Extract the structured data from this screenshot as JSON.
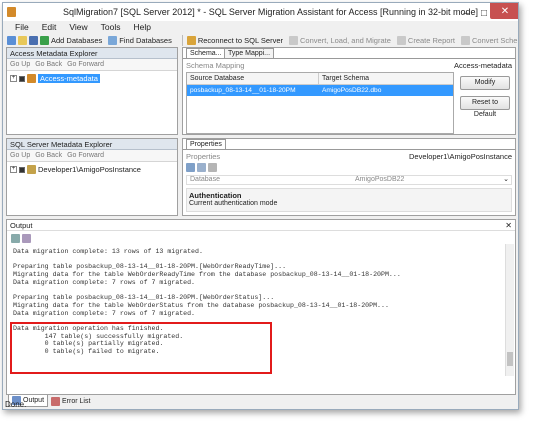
{
  "window": {
    "title": "SqlMigration7 [SQL Server 2012] * - SQL Server Migration Assistant for Access [Running in 32-bit mode]"
  },
  "menu": [
    "File",
    "Edit",
    "View",
    "Tools",
    "Help"
  ],
  "toolbar": {
    "add_databases": "Add Databases",
    "find_databases": "Find Databases",
    "reconnect": "Reconnect to SQL Server",
    "convert_load_migrate": "Convert, Load, and Migrate",
    "create_report": "Create Report",
    "convert_schema": "Convert Schema"
  },
  "access_explorer": {
    "title": "Access Metadata Explorer",
    "go_up": "Go Up",
    "go_back": "Go Back",
    "go_forward": "Go Forward",
    "root": "Access-metadata"
  },
  "schema_panel": {
    "tab_schema": "Schema...",
    "tab_type": "Type Mappi...",
    "schema_mapping": "Schema Mapping",
    "context": "Access-metadata",
    "col_source": "Source Database",
    "col_target": "Target Schema",
    "row_source": "posbackup_08-13-14__01-18-20PM",
    "row_target": "AmigoPosDB22.dbo",
    "modify": "Modify",
    "reset": "Reset to Default"
  },
  "sql_explorer": {
    "title": "SQL Server Metadata Explorer",
    "go_up": "Go Up",
    "go_back": "Go Back",
    "go_forward": "Go Forward",
    "root": "Developer1\\AmigoPosInstance"
  },
  "properties": {
    "tab": "Properties",
    "label": "Properties",
    "context": "Developer1\\AmigoPosInstance",
    "prop_name": "Database",
    "prop_value": "AmigoPosDB22",
    "section": "Authentication",
    "section_desc": "Current authentication mode"
  },
  "output": {
    "title": "Output",
    "close": "✕",
    "lines": [
      "Data migration complete: 13 rows of 13 migrated.",
      "",
      "Preparing table posbackup_08-13-14__01-18-20PM.[WebOrderReadyTime]...",
      "Migrating data for the table WebOrderReadyTime from the database posbackup_08-13-14__01-18-20PM...",
      "Data migration complete: 7 rows of 7 migrated.",
      "",
      "Preparing table posbackup_08-13-14__01-18-20PM.[WebOrderStatus]...",
      "Migrating data for the table WebOrderStatus from the database posbackup_08-13-14__01-18-20PM...",
      "Data migration complete: 7 rows of 7 migrated.",
      "",
      "Data migration operation has finished.",
      "        147 table(s) successfully migrated.",
      "        0 table(s) partially migrated.",
      "        0 table(s) failed to migrate."
    ],
    "tab_output": "Output",
    "tab_errors": "Error List"
  },
  "status": {
    "text": "Done."
  },
  "colors": {
    "selection": "#3399ff",
    "highlight_box": "#e21b1b"
  }
}
